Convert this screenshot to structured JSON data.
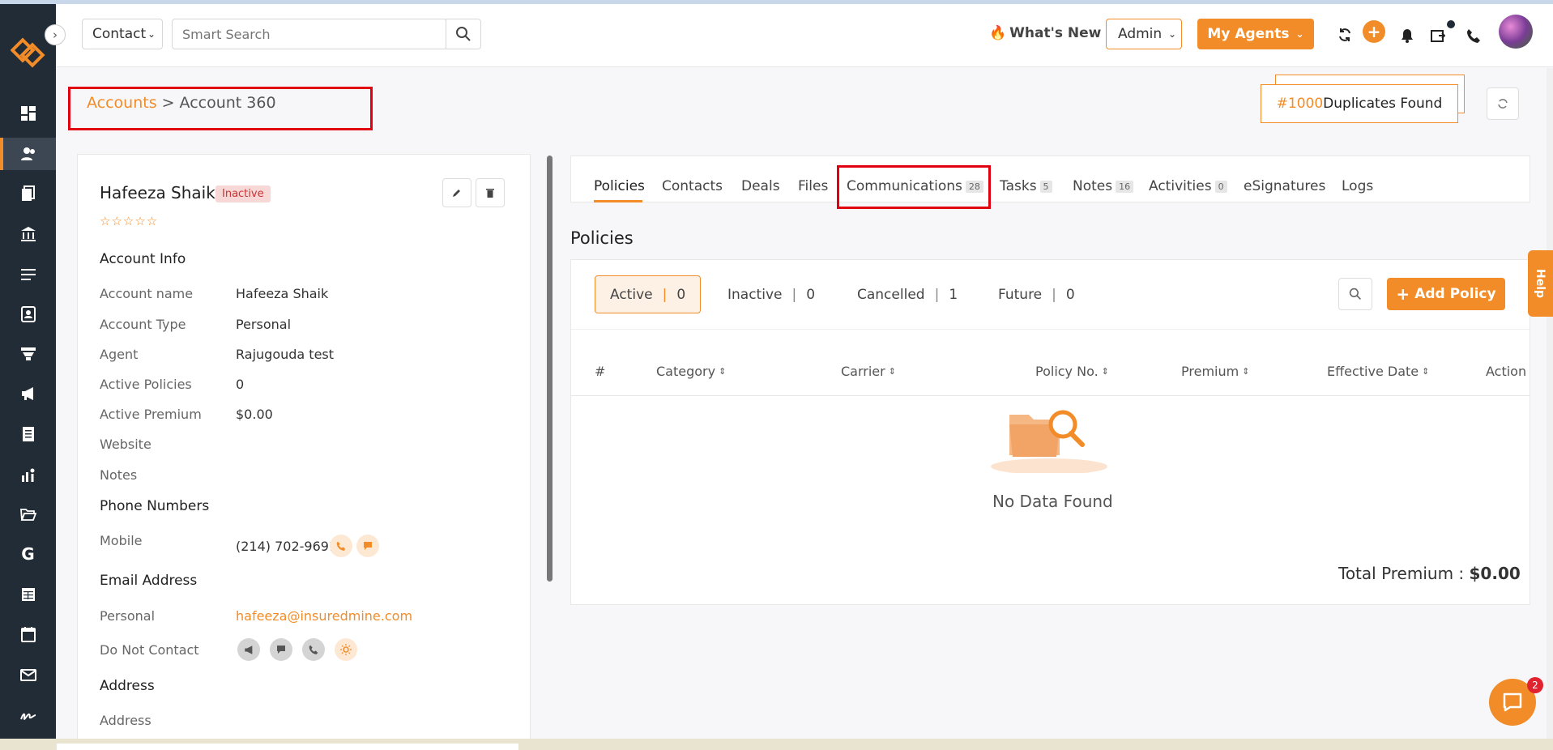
{
  "topbar": {
    "entity_select": "Contact",
    "search_placeholder": "Smart Search",
    "whats_new": "What's New",
    "role_select": "Admin",
    "my_agents": "My Agents"
  },
  "breadcrumb": {
    "parent": "Accounts",
    "separator": ">",
    "current": "Account 360"
  },
  "duplicates": {
    "count": "#1000",
    "label": "Duplicates Found"
  },
  "account": {
    "name": "Hafeeza Shaik",
    "status": "Inactive",
    "stars": "☆☆☆☆☆",
    "sections": {
      "account_info": "Account Info",
      "phone_numbers": "Phone Numbers",
      "email_address": "Email Address",
      "address": "Address"
    },
    "fields": [
      {
        "label": "Account name",
        "value": "Hafeeza Shaik"
      },
      {
        "label": "Account Type",
        "value": "Personal"
      },
      {
        "label": "Agent",
        "value": "Rajugouda test"
      },
      {
        "label": "Active Policies",
        "value": "0"
      },
      {
        "label": "Active Premium",
        "value": "$0.00"
      },
      {
        "label": "Website",
        "value": ""
      },
      {
        "label": "Notes",
        "value": ""
      }
    ],
    "phone": {
      "label": "Mobile",
      "value": "(214) 702-9691"
    },
    "email": {
      "label": "Personal",
      "value": "hafeeza@insuredmine.com"
    },
    "do_not_contact": {
      "label": "Do Not Contact"
    },
    "address": {
      "label": "Address"
    }
  },
  "tabs": [
    {
      "label": "Policies",
      "count": ""
    },
    {
      "label": "Contacts",
      "count": ""
    },
    {
      "label": "Deals",
      "count": ""
    },
    {
      "label": "Files",
      "count": ""
    },
    {
      "label": "Communications",
      "count": "28"
    },
    {
      "label": "Tasks",
      "count": "5"
    },
    {
      "label": "Notes",
      "count": "16"
    },
    {
      "label": "Activities",
      "count": "0"
    },
    {
      "label": "eSignatures",
      "count": ""
    },
    {
      "label": "Logs",
      "count": ""
    }
  ],
  "policies": {
    "title": "Policies",
    "filters": [
      {
        "label": "Active",
        "count": "0"
      },
      {
        "label": "Inactive",
        "count": "0"
      },
      {
        "label": "Cancelled",
        "count": "1"
      },
      {
        "label": "Future",
        "count": "0"
      }
    ],
    "add_button": "Add Policy",
    "columns": [
      "#",
      "Category",
      "Carrier",
      "Policy No.",
      "Premium",
      "Effective Date",
      "Action"
    ],
    "empty_text": "No Data Found",
    "total_label": "Total Premium :",
    "total_value": "$0.00"
  },
  "help": "Help",
  "chat_badge": "2",
  "colors": {
    "accent": "#f28c28",
    "sidebar": "#222c36",
    "highlight": "#e0000f"
  }
}
